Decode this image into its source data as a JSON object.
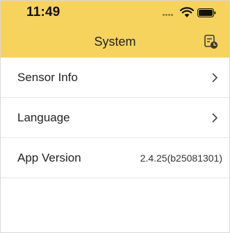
{
  "status_bar": {
    "time": "11:49",
    "icons": [
      "signal-dots-icon",
      "wifi-icon",
      "battery-icon"
    ]
  },
  "header": {
    "title": "System",
    "action_icon": "history-icon",
    "background_color": "#f6d35c"
  },
  "menu": {
    "items": [
      {
        "label": "Sensor Info",
        "icon": "chevron-right-icon"
      },
      {
        "label": "Language",
        "icon": "chevron-right-icon"
      },
      {
        "label": "App Version",
        "value": "2.4.25(b25081301)"
      }
    ]
  }
}
